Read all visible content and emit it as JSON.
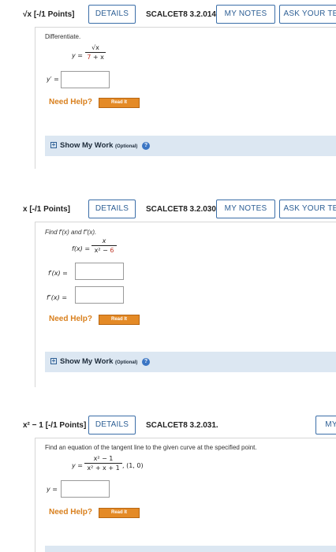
{
  "q3": {
    "num": "√x",
    "points": "[-/1 Points]",
    "details": "DETAILS",
    "code": "SCALCET8 3.2.014.",
    "my_notes": "MY NOTES",
    "ask": "ASK YOUR TE",
    "instruction": "Differentiate.",
    "eq_lhs": "y =",
    "den_a": "7",
    "den_b": " + x",
    "answer_label": "y′ =",
    "need_help": "Need Help?",
    "read_it": "Read It",
    "show_work": "Show My Work",
    "optional": "(Optional)"
  },
  "q4": {
    "num": "x",
    "points": "[-/1 Points]",
    "details": "DETAILS",
    "code": "SCALCET8 3.2.030.",
    "my_notes": "MY NOTES",
    "ask": "ASK YOUR TE",
    "instruction": "Find f′(x) and f″(x).",
    "eq_lhs": "f(x) =",
    "den_a": "x² − ",
    "den_b": "6",
    "label1": "f′(x) =",
    "label2": "f″(x) =",
    "need_help": "Need Help?",
    "read_it": "Read It",
    "show_work": "Show My Work",
    "optional": "(Optional)"
  },
  "q5": {
    "num": "x² − 1",
    "points": "[-/1 Points]",
    "details": "DETAILS",
    "code": "SCALCET8 3.2.031.",
    "my_notes": "MY",
    "instruction": "Find an equation of the tangent line to the given curve at the specified point.",
    "eq_lhs": "y =",
    "den": "x² + x + 1",
    "point": ",   (1, 0)",
    "answer_label": "y =",
    "need_help": "Need Help?",
    "read_it": "Read It"
  },
  "colors": {
    "accent": "#2d5f95",
    "help_orange": "#d9801e",
    "read_btn": "#e48a26",
    "work_bar": "#dce7f2"
  }
}
